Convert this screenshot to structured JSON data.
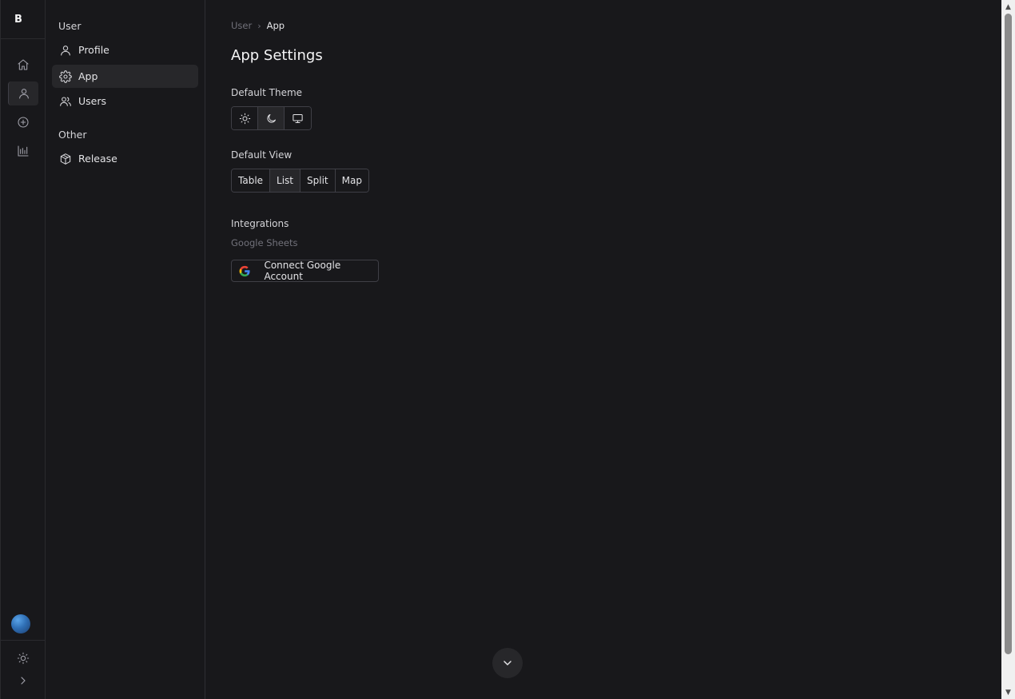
{
  "rail": {
    "logo": "B",
    "items": [
      {
        "icon": "home-icon"
      },
      {
        "icon": "user-icon"
      },
      {
        "icon": "plus-circle-icon"
      },
      {
        "icon": "bar-chart-icon"
      }
    ],
    "active_index": 1,
    "footer": {
      "theme_icon": "sun-icon",
      "expand_icon": "chevron-right-icon",
      "avatar": "avatar"
    }
  },
  "sidebar": {
    "groups": [
      {
        "label": "User",
        "items": [
          {
            "label": "Profile",
            "icon": "user-icon"
          },
          {
            "label": "App",
            "icon": "gear-icon"
          },
          {
            "label": "Users",
            "icon": "users-icon"
          }
        ]
      },
      {
        "label": "Other",
        "items": [
          {
            "label": "Release",
            "icon": "package-icon"
          }
        ]
      }
    ],
    "active_item": "App"
  },
  "main": {
    "breadcrumb": {
      "parent": "User",
      "current": "App"
    },
    "title": "App Settings",
    "theme": {
      "label": "Default Theme",
      "options": [
        {
          "icon": "sun-icon",
          "value": "light"
        },
        {
          "icon": "moon-icon",
          "value": "dark"
        },
        {
          "icon": "monitor-icon",
          "value": "system"
        }
      ],
      "selected": "dark"
    },
    "view": {
      "label": "Default View",
      "options": [
        "Table",
        "List",
        "Split",
        "Map"
      ],
      "selected": "List"
    },
    "integrations": {
      "label": "Integrations",
      "provider": "Google Sheets",
      "button_label": "Connect Google Account",
      "button_icon": "google-icon"
    },
    "scroll_button_icon": "chevron-down-icon"
  },
  "colors": {
    "background": "#18181b",
    "surface_active": "#27272a",
    "border": "#3f3f46",
    "text": "#e4e4e7",
    "muted_text": "#71717a"
  }
}
